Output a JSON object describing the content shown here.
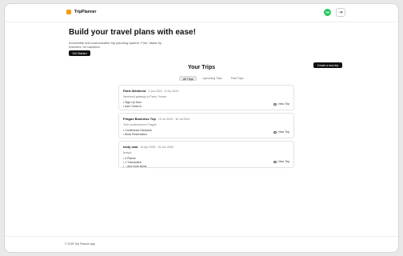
{
  "header": {
    "app_name": "TripPlanner",
    "avatar_initials": "TR",
    "logout_icon": "logout-icon"
  },
  "hero": {
    "title": "Build your travel plans with ease!",
    "subtitle": "Accessible and customizable trip planning system. Free. Made by travelers, for travelers.",
    "cta_label": "Get Started"
  },
  "trips": {
    "section_title": "Your Trips",
    "create_label": "Create a new trip",
    "tabs": [
      {
        "label": "All Trips",
        "active": true
      },
      {
        "label": "Upcoming Trips",
        "active": false
      },
      {
        "label": "Past Trips",
        "active": false
      }
    ],
    "cards": [
      {
        "title": "Paris Weekend",
        "dates": "3 Jun 2024 - 5 Jun 2024",
        "description": "Weekend getaway in Paris, France",
        "items": [
          "Sign Up Now",
          "Add Check-In"
        ],
        "view_label": "View Trip"
      },
      {
        "title": "Prague Business Trip",
        "dates": "15 Jul 2024 - 18 Jul 2024",
        "description": "Tech conference in Prague",
        "items": [
          "Conference Schedule",
          "Book Reservation"
        ],
        "view_label": "View Trip"
      },
      {
        "title": "testy east",
        "dates": "16 Apr 2025 - 23 Jun 2025",
        "description": "testy/a",
        "items": [
          "4 Places",
          "1 Transaction",
          "...and more items"
        ],
        "view_label": "View Trip"
      }
    ]
  },
  "footer": {
    "text": "© 2025 Trip Planner App"
  }
}
